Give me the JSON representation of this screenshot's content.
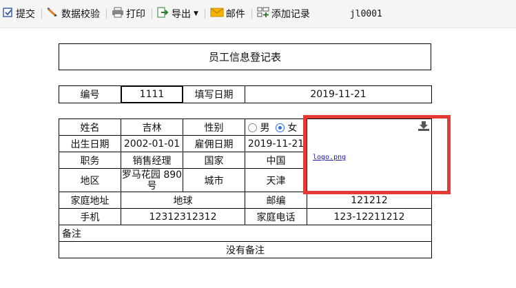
{
  "toolbar": {
    "submit": "提交",
    "validate": "数据校验",
    "print": "打印",
    "export": "导出",
    "mail": "邮件",
    "add_record": "添加记录",
    "report_id": "jl0001"
  },
  "form": {
    "title": "员工信息登记表",
    "id_label": "编号",
    "id_value": "1111",
    "fill_date_label": "填写日期",
    "fill_date_value": "2019-11-21",
    "name_label": "姓名",
    "name_value": "吉林",
    "gender_label": "性别",
    "gender_male": "男",
    "gender_female": "女",
    "gender_selected": "女",
    "birth_label": "出生日期",
    "birth_value": "2002-01-01",
    "hire_label": "雇佣日期",
    "hire_value": "2019-11-21",
    "position_label": "职务",
    "position_value": "销售经理",
    "country_label": "国家",
    "country_value": "中国",
    "region_label": "地区",
    "region_value": "罗马花园 890 号",
    "city_label": "城市",
    "city_value": "天津",
    "address_label": "家庭地址",
    "address_value": "地球",
    "postcode_label": "邮编",
    "postcode_value": "121212",
    "mobile_label": "手机",
    "mobile_value": "12312312312",
    "home_phone_label": "家庭电话",
    "home_phone_value": "123-12211212",
    "remark_label": "备注",
    "remark_value": "没有备注",
    "photo_file": "logo.png"
  },
  "colors": {
    "highlight": "#e53935",
    "radio_selected": "#2b6fd6",
    "link": "#1a1aa6"
  }
}
